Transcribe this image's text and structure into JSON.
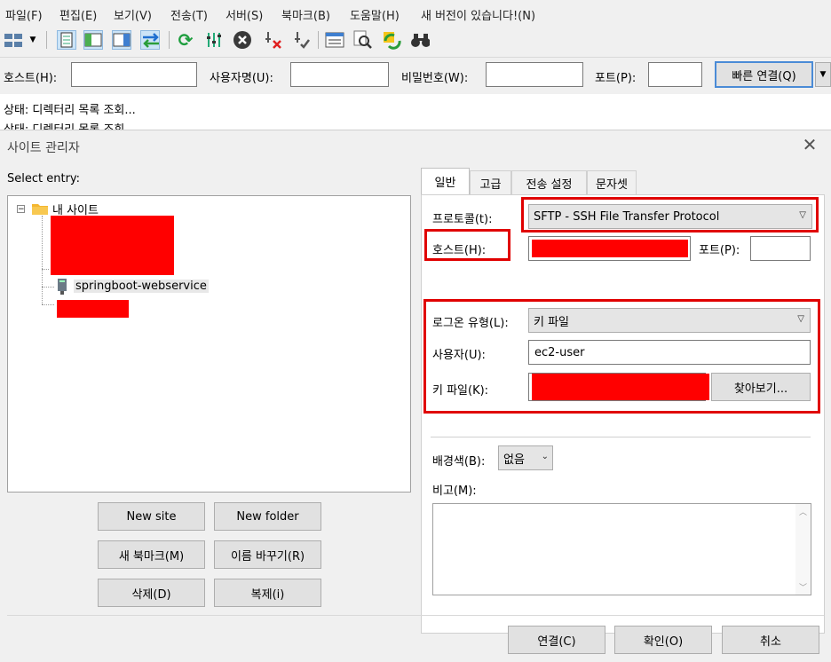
{
  "menu": [
    "파일(F)",
    "편집(E)",
    "보기(V)",
    "전송(T)",
    "서버(S)",
    "북마크(B)",
    "도움말(H)",
    "새 버전이 있습니다!(N)"
  ],
  "quickconnect": {
    "host_label": "호스트(H):",
    "user_label": "사용자명(U):",
    "pass_label": "비밀번호(W):",
    "port_label": "포트(P):",
    "connect_label": "빠른 연결(Q)"
  },
  "log": {
    "line1": "상태:  디렉터리 목록 조회...",
    "line2": "상태:  디렉터리 목록 조회..."
  },
  "dialog": {
    "title": "사이트 관리자",
    "select_entry": "Select entry:",
    "tree": {
      "root": "내 사이트",
      "site": "springboot-webservice"
    },
    "buttons": {
      "new_site": "New site",
      "new_folder": "New folder",
      "new_bookmark": "새 북마크(M)",
      "rename": "이름 바꾸기(R)",
      "delete": "삭제(D)",
      "duplicate": "복제(i)",
      "connect": "연결(C)",
      "ok": "확인(O)",
      "cancel": "취소"
    },
    "tabs": [
      "일반",
      "고급",
      "전송 설정",
      "문자셋"
    ],
    "general": {
      "protocol_label": "프로토콜(t):",
      "protocol_value": "SFTP - SSH File Transfer Protocol",
      "host_label": "호스트(H):",
      "port_label": "포트(P):",
      "logon_label": "로그온 유형(L):",
      "logon_value": "키 파일",
      "user_label": "사용자(U):",
      "user_value": "ec2-user",
      "keyfile_label": "키 파일(K):",
      "browse_label": "찾아보기...",
      "bgcolor_label": "배경색(B):",
      "bgcolor_value": "없음",
      "comments_label": "비고(M):"
    }
  }
}
